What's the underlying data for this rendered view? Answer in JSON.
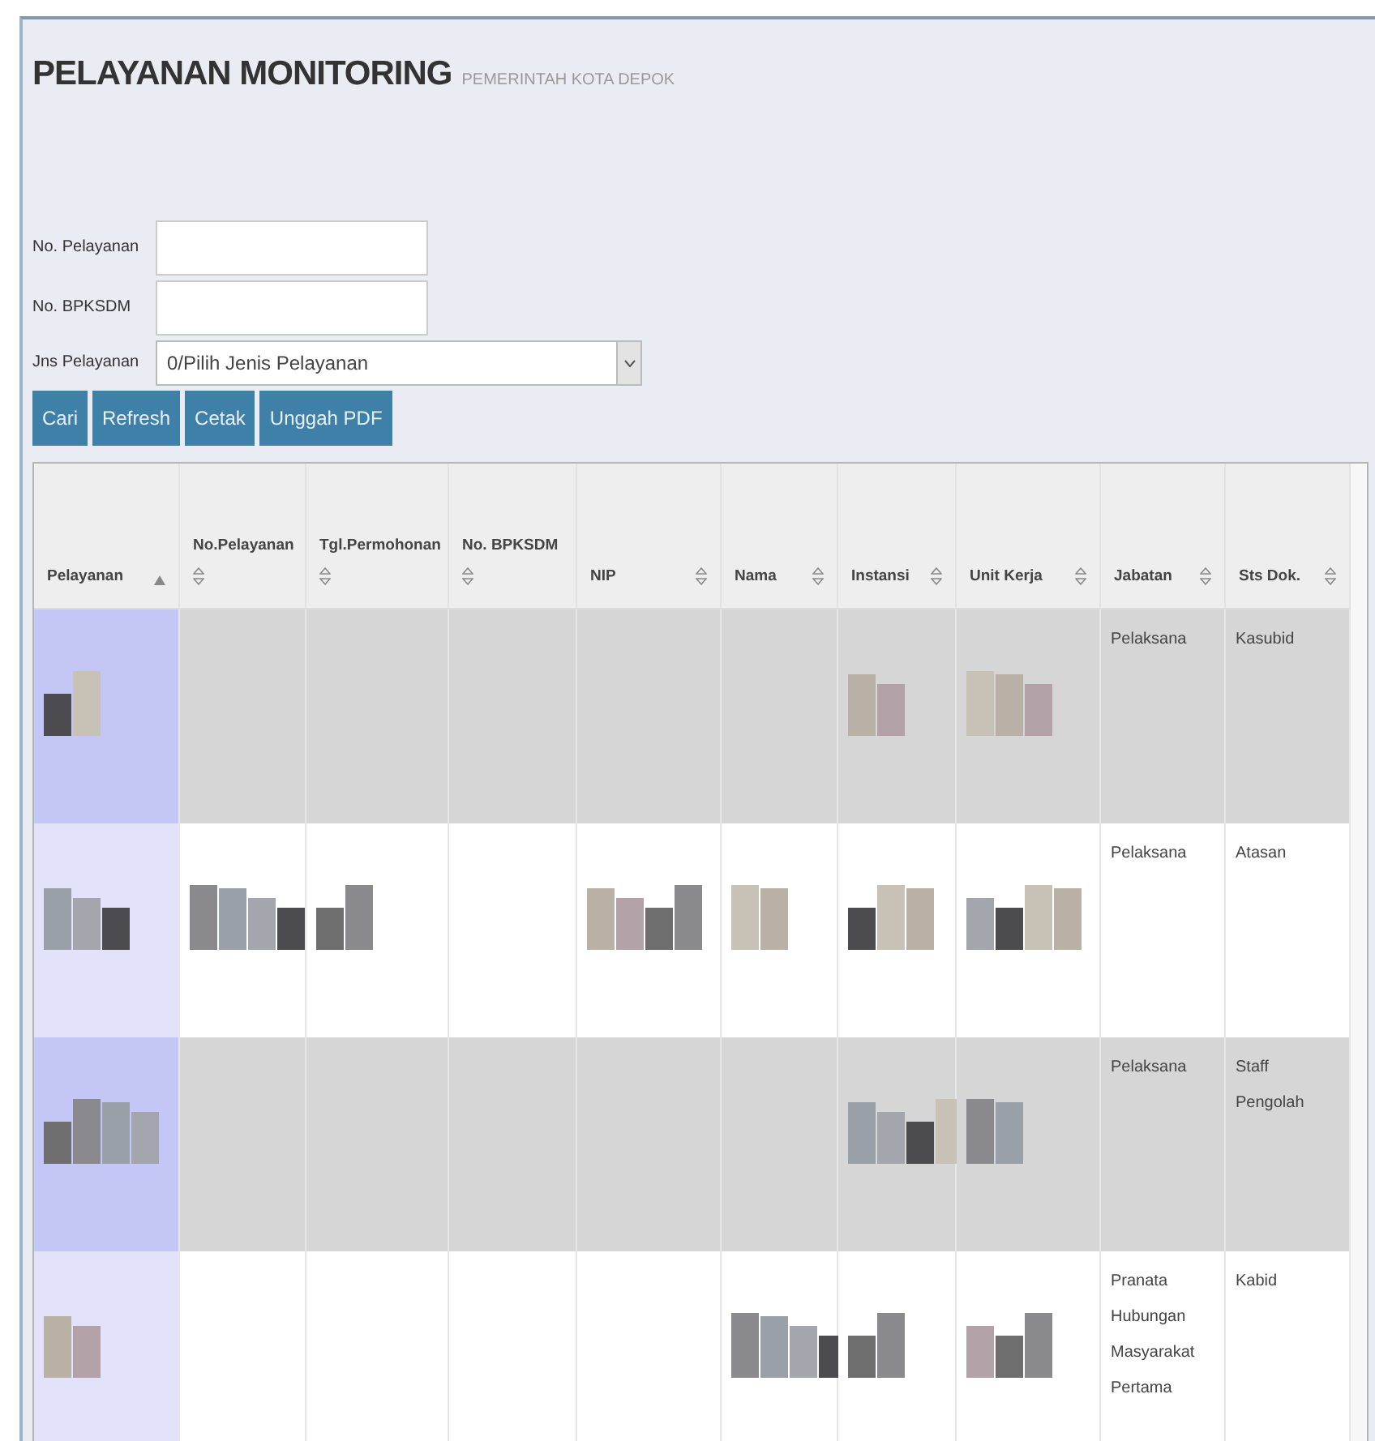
{
  "header": {
    "title": "PELAYANAN MONITORING",
    "subtitle": "PEMERINTAH KOTA DEPOK"
  },
  "form": {
    "fields": [
      {
        "label": "No. Pelayanan",
        "kind": "text"
      },
      {
        "label": "No. BPKSDM",
        "kind": "text"
      },
      {
        "label": "Jns Pelayanan",
        "kind": "select",
        "value": "0/Pilih Jenis Pelayanan"
      }
    ]
  },
  "buttons": [
    "Cari",
    "Refresh",
    "Cetak",
    "Unggah PDF"
  ],
  "table": {
    "columns": [
      {
        "label": "Pelayanan",
        "sorted": true
      },
      {
        "label": "No.Pelayanan",
        "sorted": false
      },
      {
        "label": "Tgl.Permohonan",
        "sorted": false
      },
      {
        "label": "No. BPKSDM",
        "sorted": false
      },
      {
        "label": "NIP",
        "sorted": false
      },
      {
        "label": "Nama",
        "sorted": false
      },
      {
        "label": "Instansi",
        "sorted": false
      },
      {
        "label": "Unit Kerja",
        "sorted": false
      },
      {
        "label": "Jabatan",
        "sorted": false
      },
      {
        "label": "Sts Dok.",
        "sorted": false
      }
    ],
    "rows": [
      {
        "cells": [
          {
            "redacted": true
          },
          {
            "redacted": false
          },
          {
            "redacted": false
          },
          {
            "redacted": false
          },
          {
            "redacted": false
          },
          {
            "redacted": false
          },
          {
            "redacted": true
          },
          {
            "redacted": true
          },
          {
            "text": "Pelaksana"
          },
          {
            "text": "Kasubid"
          }
        ]
      },
      {
        "cells": [
          {
            "redacted": true
          },
          {
            "redacted": true
          },
          {
            "redacted": true
          },
          {
            "redacted": false
          },
          {
            "redacted": true
          },
          {
            "redacted": true
          },
          {
            "redacted": true
          },
          {
            "redacted": true
          },
          {
            "text": "Pelaksana"
          },
          {
            "text": "Atasan"
          }
        ]
      },
      {
        "cells": [
          {
            "redacted": true
          },
          {
            "redacted": false
          },
          {
            "redacted": false
          },
          {
            "redacted": false
          },
          {
            "redacted": false
          },
          {
            "redacted": false
          },
          {
            "redacted": true
          },
          {
            "redacted": true
          },
          {
            "text": "Pelaksana"
          },
          {
            "text": "Staff Pengolah"
          }
        ]
      },
      {
        "cells": [
          {
            "redacted": true
          },
          {
            "redacted": false
          },
          {
            "redacted": false
          },
          {
            "redacted": false
          },
          {
            "redacted": false
          },
          {
            "redacted": true
          },
          {
            "redacted": true
          },
          {
            "redacted": true
          },
          {
            "text": "Pranata Hubungan Masyarakat Pertama"
          },
          {
            "text": "Kabid"
          }
        ]
      }
    ]
  }
}
